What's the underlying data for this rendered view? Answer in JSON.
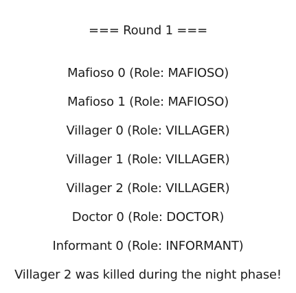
{
  "round_header": "=== Round 1 ===",
  "players": [
    "Mafioso 0 (Role: MAFIOSO)",
    "Mafioso 1 (Role: MAFIOSO)",
    "Villager 0 (Role: VILLAGER)",
    "Villager 1 (Role: VILLAGER)",
    "Villager 2 (Role: VILLAGER)",
    "Doctor 0 (Role: DOCTOR)",
    "Informant 0 (Role: INFORMANT)"
  ],
  "event_message": "Villager 2 was killed during the night phase!"
}
